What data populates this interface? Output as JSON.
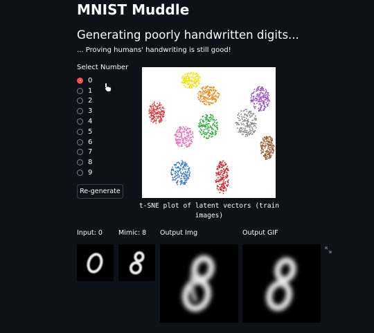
{
  "app": {
    "title": "MNIST Muddle",
    "subtitle": "Generating poorly handwritten digits...",
    "tagline": "... Proving humans' handwriting is still good!"
  },
  "selector": {
    "label": "Select Number",
    "options": [
      "0",
      "1",
      "2",
      "3",
      "4",
      "5",
      "6",
      "7",
      "8",
      "9"
    ],
    "selected": "0"
  },
  "regenerate_button": "Re-generate",
  "plot": {
    "caption": "t-SNE plot of latent vectors (train images)",
    "cluster_colors": [
      "#f5e11c",
      "#f58a1c",
      "#9a4ec9",
      "#e23b3b",
      "#888888",
      "#2bb03a",
      "#ee6fb9",
      "#9b5a34",
      "#3a7ad0",
      "#d8232a"
    ]
  },
  "outputs": {
    "input_label": "Input: 0",
    "mimic_label": "Mimic: 8",
    "output_img_label": "Output Img",
    "output_gif_label": "Output GIF"
  },
  "colors": {
    "background": "#0e1117",
    "accent": "#ff4b4b",
    "text": "#fafafa"
  }
}
